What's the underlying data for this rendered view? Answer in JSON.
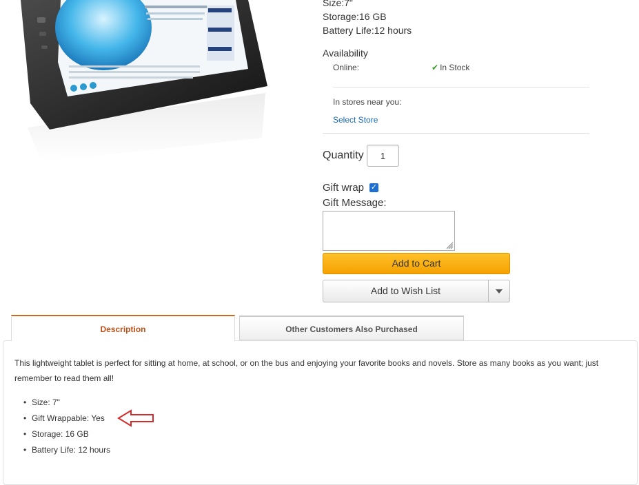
{
  "specs": {
    "size": "Size:7\"",
    "storage": "Storage:16 GB",
    "battery": "Battery Life:12 hours"
  },
  "availability": {
    "title": "Availability",
    "online_label": "Online:",
    "online_status": "In Stock",
    "stores_label": "In stores near you:",
    "select_store": "Select Store"
  },
  "quantity": {
    "label": "Quantity",
    "value": "1"
  },
  "gift": {
    "wrap_label": "Gift wrap",
    "wrap_checked": true,
    "message_label": "Gift Message:"
  },
  "buttons": {
    "add_to_cart": "Add to Cart",
    "add_to_wish_list": "Add to Wish List"
  },
  "tabs": [
    {
      "label": "Description",
      "active": true
    },
    {
      "label": "Other Customers Also Purchased",
      "active": false
    }
  ],
  "description": {
    "text": "This lightweight tablet is perfect for sitting at home, at school, or on the bus and enjoying your favorite books and novels. Store as many books as you want; just remember to read them all!",
    "features": [
      "Size: 7\"",
      "Gift Wrappable: Yes",
      "Storage: 16 GB",
      "Battery Life: 12 hours"
    ]
  },
  "colors": {
    "accent_orange": "#f5a100",
    "tab_active_text": "#c0501a",
    "link_blue": "#1a6ab5",
    "in_stock_green": "#3a9a2a",
    "annotation_arrow": "#d42a2a"
  },
  "icons": {
    "in_stock": "checkmark-icon",
    "dropdown": "chevron-down-icon",
    "annotation": "left-arrow-icon"
  }
}
